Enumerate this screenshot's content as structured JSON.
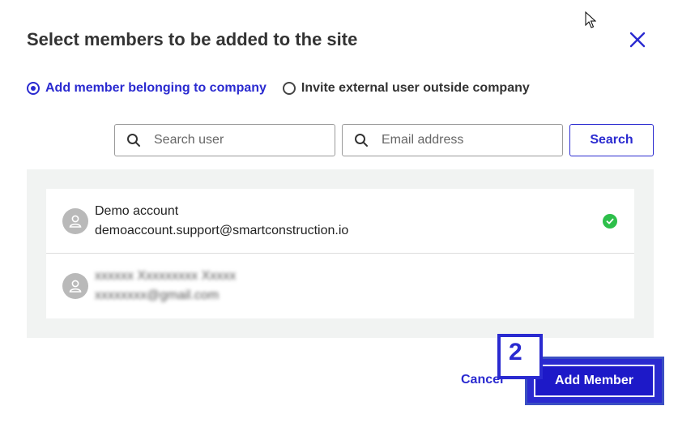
{
  "dialog": {
    "title": "Select members to be added to the site"
  },
  "radio_options": [
    {
      "label": "Add member belonging to company",
      "selected": true
    },
    {
      "label": "Invite external user outside company",
      "selected": false
    }
  ],
  "search": {
    "user_placeholder": "Search user",
    "email_placeholder": "Email address",
    "button_label": "Search"
  },
  "members": [
    {
      "name": "Demo account",
      "email": "demoaccount.support@smartconstruction.io",
      "selected": true
    },
    {
      "name": "xxxxxx Xxxxxxxxx Xxxxx",
      "email": "xxxxxxxx@gmail.com",
      "selected": false,
      "blurred": true
    }
  ],
  "footer": {
    "cancel_label": "Cancel",
    "add_label": "Add Member",
    "step_number": "2"
  },
  "colors": {
    "accent": "#2a2ad0",
    "success": "#2dbf4a",
    "panel_bg": "#f1f3f2"
  },
  "icons": [
    "close-icon",
    "search-icon",
    "user-avatar-icon",
    "check-circle-icon",
    "mouse-cursor-icon"
  ]
}
